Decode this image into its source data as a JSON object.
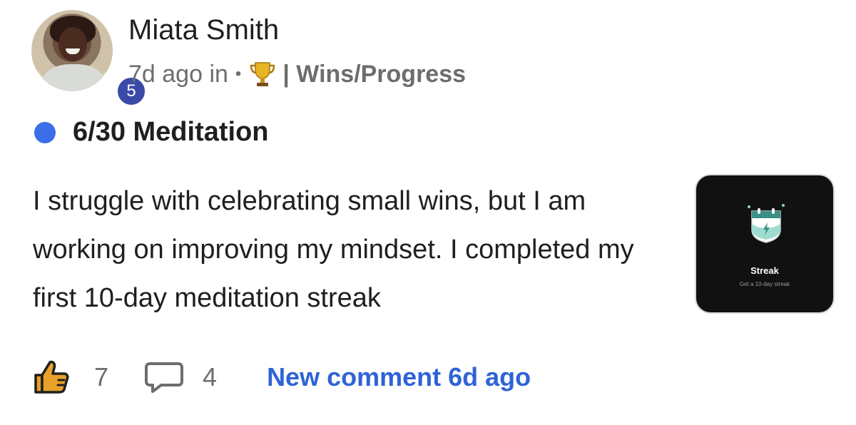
{
  "author": {
    "name": "Miata Smith",
    "level": "5"
  },
  "meta": {
    "time_ago": "7d ago in",
    "separator": "•",
    "category": "| Wins/Progress"
  },
  "post": {
    "title": "6/30 Meditation",
    "body": "I struggle with celebrating small wins, but I am working on improving my mindset. I completed my first 10-day meditation streak"
  },
  "attachment": {
    "title": "Streak",
    "subtitle": "Get a 10-day streak"
  },
  "actions": {
    "likes": "7",
    "comments": "4",
    "new_comment": "New comment 6d ago"
  },
  "colors": {
    "accent": "#3b6ee8",
    "link": "#2f63d6",
    "level_badge": "#3b4aa8"
  },
  "icons": [
    "trophy-icon",
    "like-icon",
    "comment-icon",
    "calendar-lightning-icon"
  ]
}
